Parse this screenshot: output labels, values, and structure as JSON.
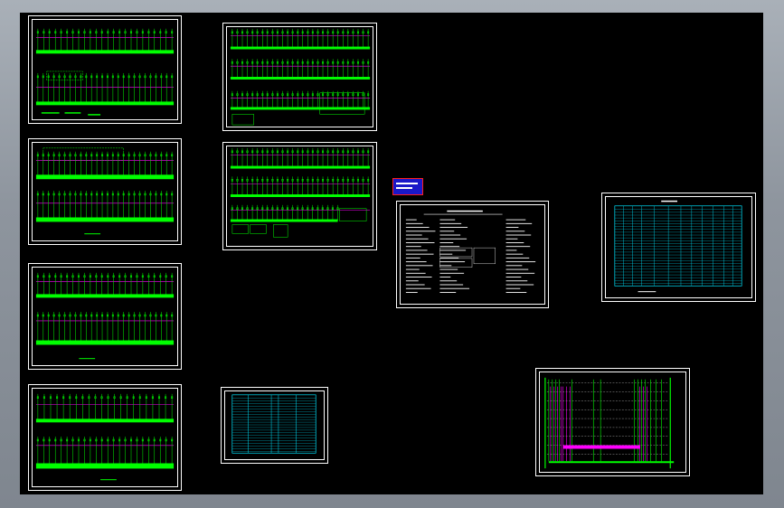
{
  "app": {
    "title": "",
    "space": "model"
  },
  "colors": {
    "background": "#000000",
    "frame": "#ffffff",
    "wire_green": "#00ff00",
    "wire_magenta": "#ff00ff",
    "wire_red": "#ff2020",
    "table_cyan": "#00e5ff",
    "legend_blue": "#1a18c8"
  },
  "sheets": [
    {
      "id": "sld-1",
      "kind": "single-line-diagram"
    },
    {
      "id": "sld-2",
      "kind": "single-line-diagram"
    },
    {
      "id": "sld-3",
      "kind": "single-line-diagram"
    },
    {
      "id": "sld-4",
      "kind": "single-line-diagram"
    },
    {
      "id": "sld-5",
      "kind": "single-line-diagram"
    },
    {
      "id": "sld-6",
      "kind": "single-line-diagram"
    },
    {
      "id": "table-1",
      "kind": "schedule-table"
    },
    {
      "id": "notes",
      "kind": "design-notes"
    },
    {
      "id": "table-2",
      "kind": "schedule-table"
    },
    {
      "id": "riser",
      "kind": "riser-diagram"
    }
  ],
  "legend": {
    "icon": "legend-swatch-icon"
  }
}
